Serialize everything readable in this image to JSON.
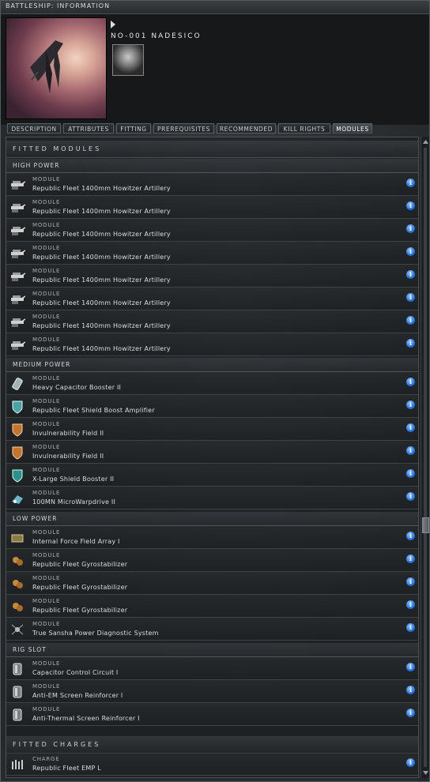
{
  "window": {
    "title": "BATTLESHIP: INFORMATION"
  },
  "ship": {
    "name": "NO-001  NADESICO"
  },
  "tabs": [
    {
      "label": "DESCRIPTION"
    },
    {
      "label": "ATTRIBUTES"
    },
    {
      "label": "FITTING"
    },
    {
      "label": "PREREQUISITES"
    },
    {
      "label": "RECOMMENDED"
    },
    {
      "label": "KILL RIGHTS"
    },
    {
      "label": "MODULES"
    }
  ],
  "active_tab": "MODULES",
  "fitted_modules_title": "FITTED MODULES",
  "fitted_charges_title": "FITTED CHARGES",
  "sections": {
    "high": {
      "label": "HIGH POWER",
      "items": [
        {
          "cat": "MODULE",
          "name": "Republic Fleet 1400mm Howitzer Artillery",
          "icon": "artillery-icon"
        },
        {
          "cat": "MODULE",
          "name": "Republic Fleet 1400mm Howitzer Artillery",
          "icon": "artillery-icon"
        },
        {
          "cat": "MODULE",
          "name": "Republic Fleet 1400mm Howitzer Artillery",
          "icon": "artillery-icon"
        },
        {
          "cat": "MODULE",
          "name": "Republic Fleet 1400mm Howitzer Artillery",
          "icon": "artillery-icon"
        },
        {
          "cat": "MODULE",
          "name": "Republic Fleet 1400mm Howitzer Artillery",
          "icon": "artillery-icon"
        },
        {
          "cat": "MODULE",
          "name": "Republic Fleet 1400mm Howitzer Artillery",
          "icon": "artillery-icon"
        },
        {
          "cat": "MODULE",
          "name": "Republic Fleet 1400mm Howitzer Artillery",
          "icon": "artillery-icon"
        },
        {
          "cat": "MODULE",
          "name": "Republic Fleet 1400mm Howitzer Artillery",
          "icon": "artillery-icon"
        }
      ]
    },
    "medium": {
      "label": "MEDIUM POWER",
      "items": [
        {
          "cat": "MODULE",
          "name": "Heavy Capacitor Booster II",
          "icon": "capacitor-booster-icon"
        },
        {
          "cat": "MODULE",
          "name": "Republic Fleet Shield Boost Amplifier",
          "icon": "shield-amplifier-icon"
        },
        {
          "cat": "MODULE",
          "name": "Invulnerability Field II",
          "icon": "invulnerability-field-icon"
        },
        {
          "cat": "MODULE",
          "name": "Invulnerability Field II",
          "icon": "invulnerability-field-icon"
        },
        {
          "cat": "MODULE",
          "name": "X-Large Shield Booster II",
          "icon": "shield-booster-icon"
        },
        {
          "cat": "MODULE",
          "name": "100MN MicroWarpdrive II",
          "icon": "microwarpdrive-icon"
        }
      ]
    },
    "low": {
      "label": "LOW POWER",
      "items": [
        {
          "cat": "MODULE",
          "name": "Internal Force Field Array I",
          "icon": "force-field-array-icon"
        },
        {
          "cat": "MODULE",
          "name": "Republic Fleet Gyrostabilizer",
          "icon": "gyrostabilizer-icon"
        },
        {
          "cat": "MODULE",
          "name": "Republic Fleet Gyrostabilizer",
          "icon": "gyrostabilizer-icon"
        },
        {
          "cat": "MODULE",
          "name": "Republic Fleet Gyrostabilizer",
          "icon": "gyrostabilizer-icon"
        },
        {
          "cat": "MODULE",
          "name": "True Sansha Power Diagnostic System",
          "icon": "power-diagnostic-icon"
        }
      ]
    },
    "rig": {
      "label": "RIG SLOT",
      "items": [
        {
          "cat": "MODULE",
          "name": "Capacitor Control Circuit I",
          "icon": "rig-icon"
        },
        {
          "cat": "MODULE",
          "name": "Anti-EM Screen Reinforcer I",
          "icon": "rig-icon"
        },
        {
          "cat": "MODULE",
          "name": "Anti-Thermal Screen Reinforcer I",
          "icon": "rig-icon"
        }
      ]
    },
    "charges": {
      "items": [
        {
          "cat": "CHARGE",
          "name": "Republic Fleet EMP L",
          "icon": "projectile-ammo-icon"
        }
      ]
    }
  },
  "info_glyph": "i",
  "colors": {
    "accent_info": "#1f6ee0",
    "text": "#d9dde0",
    "panel": "#2c3032"
  }
}
